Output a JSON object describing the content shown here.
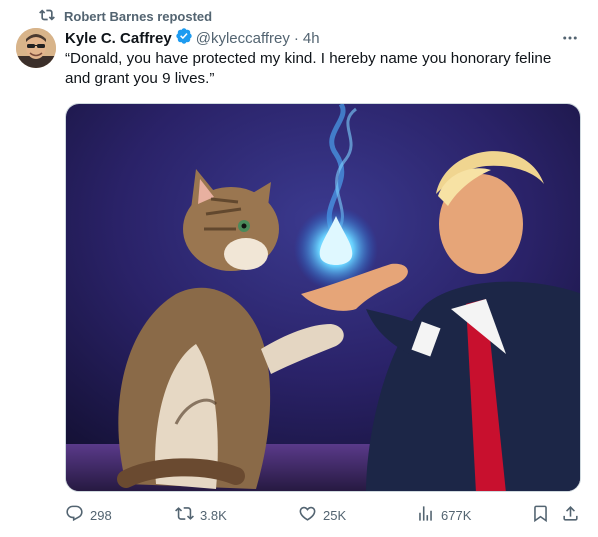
{
  "repost": {
    "label": "Robert Barnes reposted"
  },
  "author": {
    "name": "Kyle C. Caffrey",
    "handle": "@kyleccaffrey",
    "separator": "·",
    "time": "4h"
  },
  "tweet": {
    "text": "“Donald, you have protected my kind. I hereby name you honorary feline and grant you 9 lives.”"
  },
  "stats": {
    "replies": "298",
    "reposts": "3.8K",
    "likes": "25K",
    "views": "677K"
  },
  "icons": {
    "repost": "repost-icon",
    "verified": "verified-badge-icon",
    "more": "more-dots-icon",
    "reply": "reply-icon",
    "like": "heart-icon",
    "views": "views-chart-icon",
    "bookmark": "bookmark-icon",
    "share": "share-icon"
  },
  "colors": {
    "secondary_text": "#536471",
    "verified_blue": "#1d9bf0",
    "primary_text": "#0f1419"
  }
}
